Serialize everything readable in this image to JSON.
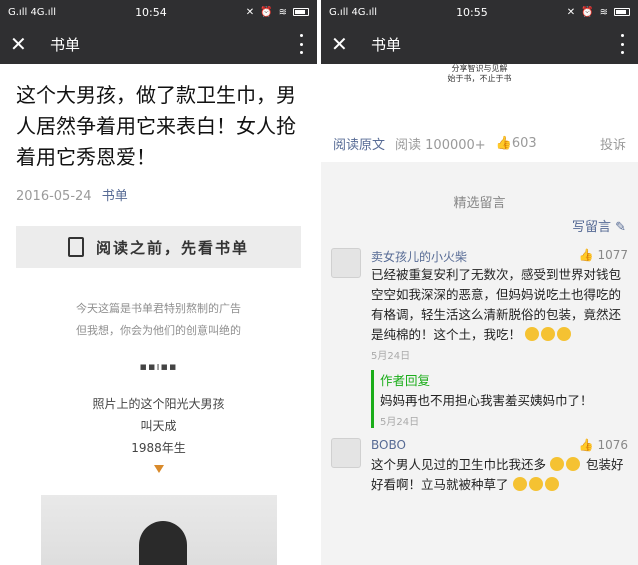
{
  "left": {
    "status": {
      "signal": "G.ıll 4G.ıll",
      "time": "10:54"
    },
    "nav": {
      "title": "书单"
    },
    "article": {
      "title": "这个大男孩，做了款卫生巾，男人居然争着用它来表白！女人抢着用它秀恩爱！",
      "date": "2016-05-24",
      "author": "书单",
      "banner": "阅读之前，先看书单",
      "intro_line1": "今天这篇是书单君特别熬制的广告",
      "intro_line2": "但我想，你会为他们的创意叫绝的",
      "dots": "▪▪ı▪▪",
      "poem_line1": "照片上的这个阳光大男孩",
      "poem_line2": "叫天成",
      "poem_line3": "1988年生"
    }
  },
  "right": {
    "status": {
      "signal": "G.ıll 4G.ıll",
      "time": "10:55"
    },
    "nav": {
      "title": "书单"
    },
    "top_strip_line1": "分享智识与见解",
    "top_strip_line2": "始于书，不止于书",
    "actions": {
      "read_original": "阅读原文",
      "reads": "阅读 100000+",
      "likes": "603",
      "report": "投诉"
    },
    "section_title": "精选留言",
    "write_comment": "写留言",
    "comments": [
      {
        "nickname": "卖女孩儿的小火柴",
        "likes": "1077",
        "text": "已经被重复安利了无数次，感受到世界对钱包空空如我深深的恶意，但妈妈说吃土也得吃的有格调，轻生活这么清新脱俗的包装，竟然还是纯棉的！这个土，我吃！",
        "date": "5月24日",
        "reply_label": "作者回复",
        "reply_text": "妈妈再也不用担心我害羞买姨妈巾了！",
        "reply_date": "5月24日"
      },
      {
        "nickname": "BOBO",
        "likes": "1076",
        "text": "这个男人见过的卫生巾比我还多",
        "text2": "包装好好看啊！立马就被种草了"
      }
    ]
  }
}
